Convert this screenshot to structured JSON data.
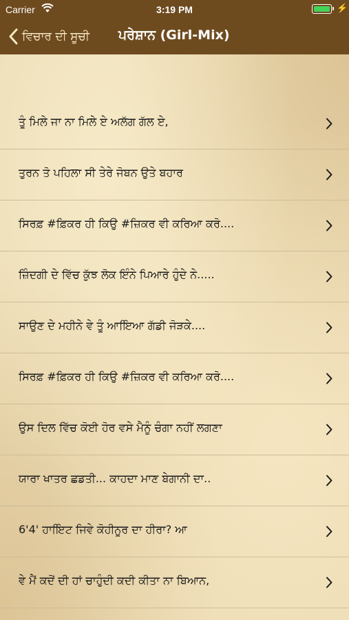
{
  "status_bar": {
    "carrier": "Carrier",
    "time": "3:19 PM",
    "icons": [
      "wifi-icon",
      "battery-icon",
      "charging-bolt-icon"
    ],
    "battery_level": 1.0,
    "battery_color": "#44d35a"
  },
  "nav": {
    "back_label": "ਵਿਚਾਰ ਦੀ ਸੂਚੀ",
    "title": "ਪਰੇਸ਼ਾਨ (Girl-Mix)",
    "bar_color": "#6e4b1f"
  },
  "items": [
    {
      "label": "ਤੂੰ ਮਿਲੇ ਜਾ ਨਾ ਮਿਲੇ ਏ ਅਲੱਗ ਗੱਲ ਏ,"
    },
    {
      "label": "ਤੁਰਨ ਤੋ ਪਹਿਲਾ ਸੀ ਤੇਰੇ  ਜੋਬਨ ਉਤੇ ਬਹਾਰ"
    },
    {
      "label": "ਸਿਰਫ਼ #ਫ਼ਿਕਰ ਹੀ ਕਿਉ #ਜ਼ਿਕਰ ਵੀ ਕਰਿਆ ਕਰੋ...."
    },
    {
      "label": "ਜ਼ਿੰਦਗੀ ਦੇ ਵਿੱਚ ਕੁੱਝ ਲੋਕ ਇੰਨੇ ਪਿਆਰੇ ਹੁੰਦੇ ਨੇ....."
    },
    {
      "label": "ਸਾਉਣ ਦੇ ਮਹੀਨੇ ਵੇ ਤੂੰ ਆਇਿਆ ਗੱਡੀ ਜੋੜਕੇ...."
    },
    {
      "label": "ਸਿਰਫ਼ #ਫ਼ਿਕਰ ਹੀ ਕਿਉ #ਜ਼ਿਕਰ ਵੀ ਕਰਿਆ ਕਰੋ...."
    },
    {
      "label": "ਉਸ ਦਿਲ ਵਿੱਚ ਕੋਈ ਹੋਰ ਵਸੇ ਮੈਨੂੰ ਚੰਗਾ ਨਹੀਂ ਲਗਣਾ"
    },
    {
      "label": "ਯਾਰਾ ਖਾਤਰ ਛਡਤੀ... ਕਾਹਦਾ ਮਾਣ ਬੇਗਾਨੀ ਦਾ.."
    },
    {
      "label": "6'4' ਹਾਇਿਟ ਜਿਵੇ ਕੋਹੀਨੂਰ ਦਾ ਹੀਰਾ? ਆ"
    },
    {
      "label": "ਵੇ ਮੈਂ ਕਦੋਂ ਦੀ ਹਾਂ ਚਾਹੁੰਦੀ ਕਦੀ ਕੀਤਾ ਨਾ ਬਿਆਨ,"
    }
  ]
}
